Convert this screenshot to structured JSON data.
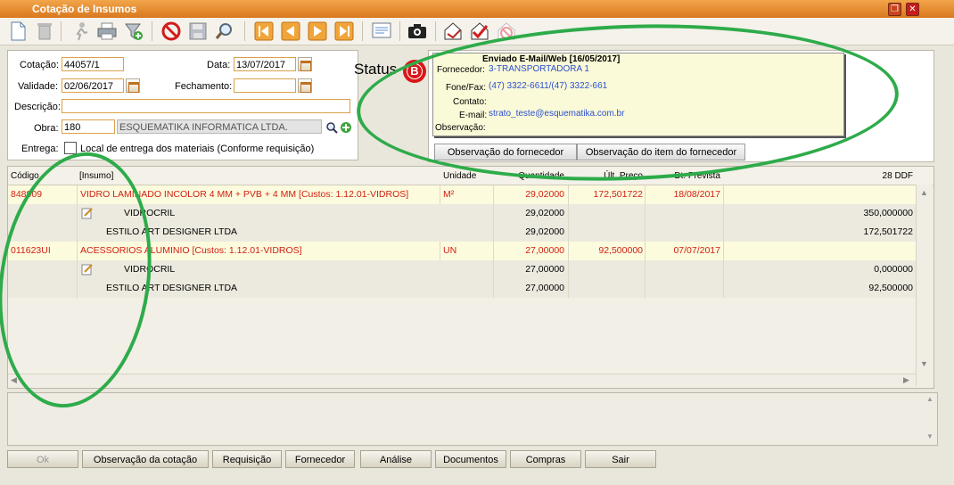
{
  "window": {
    "title": "Cotação de Insumos"
  },
  "header": {
    "cotacao_label": "Cotação:",
    "cotacao_value": "44057/1",
    "data_label": "Data:",
    "data_value": "13/07/2017",
    "validade_label": "Validade:",
    "validade_value": "02/06/2017",
    "fechamento_label": "Fechamento:",
    "fechamento_value": "",
    "descricao_label": "Descrição:",
    "descricao_value": "",
    "obra_label": "Obra:",
    "obra_code": "180",
    "obra_name": "ESQUEMATIKA INFORMATICA LTDA.",
    "entrega_label": "Entrega:",
    "entrega_text": "Local de entrega dos materiais (Conforme requisição)",
    "status_label": "Status",
    "status_badge": "B"
  },
  "supplier": {
    "header": "Enviado E-Mail/Web [16/05/2017]",
    "fornecedor_label": "Fornecedor:",
    "fornecedor_value": "3-TRANSPORTADORA 1",
    "fone_label": "Fone/Fax:",
    "fone_value": "(47) 3322-6611/(47) 3322-661",
    "contato_label": "Contato:",
    "contato_value": "",
    "email_label": "E-mail:",
    "email_value": "strato_teste@esquematika.com.br",
    "obs_label": "Observação:",
    "obs_value": "",
    "tab1": "Observação do fornecedor",
    "tab2": "Observação do item do fornecedor"
  },
  "grid": {
    "columns": {
      "codigo": "Código",
      "insumo": "[Insumo]",
      "unidade": "Unidade",
      "quantidade": "Quantidade",
      "ult_preco": "Últ. Preço",
      "dt_prevista": "Dt. Prevista",
      "ddf": "28 DDF"
    },
    "rows": [
      {
        "codigo": "848909",
        "insumo": "VIDRO LAMINADO INCOLOR 4 MM + PVB + 4 MM [Custos: 1.12.01-VIDROS]",
        "unidade": "M²",
        "quantidade": "29,02000",
        "ult_preco": "172,501722",
        "dt_prevista": "18/08/2017",
        "ddf": ""
      },
      {
        "codigo": "",
        "insumo": "VIDROCRIL",
        "unidade": "",
        "quantidade": "29,02000",
        "ult_preco": "",
        "dt_prevista": "",
        "ddf": "350,000000"
      },
      {
        "codigo": "",
        "insumo": "ESTILO ART DESIGNER LTDA",
        "unidade": "",
        "quantidade": "29,02000",
        "ult_preco": "",
        "dt_prevista": "",
        "ddf": "172,501722"
      },
      {
        "codigo": "011623UI",
        "insumo": "ACESSORIOS ALUMINIO [Custos: 1.12.01-VIDROS]",
        "unidade": "UN",
        "quantidade": "27,00000",
        "ult_preco": "92,500000",
        "dt_prevista": "07/07/2017",
        "ddf": ""
      },
      {
        "codigo": "",
        "insumo": "VIDROCRIL",
        "unidade": "",
        "quantidade": "27,00000",
        "ult_preco": "",
        "dt_prevista": "",
        "ddf": "0,000000"
      },
      {
        "codigo": "",
        "insumo": "ESTILO ART DESIGNER LTDA",
        "unidade": "",
        "quantidade": "27,00000",
        "ult_preco": "",
        "dt_prevista": "",
        "ddf": "92,500000"
      }
    ]
  },
  "buttons": {
    "ok": "Ok",
    "obs_cotacao": "Observação da cotação",
    "requisicao": "Requisição",
    "fornecedor": "Fornecedor",
    "analise": "Análise",
    "documentos": "Documentos",
    "compras": "Compras",
    "sair": "Sair"
  },
  "colors": {
    "title_orange": "#e28a2c",
    "accent_red": "#d02010",
    "annotation_green": "#2eab4a",
    "supplier_blue": "#2a4fd0"
  }
}
